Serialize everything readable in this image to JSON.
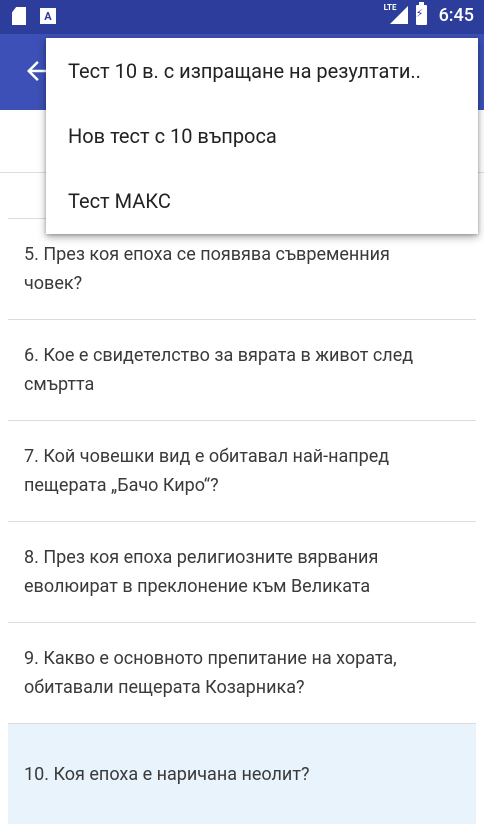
{
  "status_bar": {
    "time": "6:45",
    "a_glyph": "A",
    "network_label": "LTE",
    "icons": [
      "sd-card-icon",
      "a-notification-icon",
      "lte-signal-icon",
      "battery-charging-icon"
    ]
  },
  "app_bar": {
    "back_icon": "arrow-back-icon",
    "color": "#3c50b7"
  },
  "menu": {
    "items": [
      {
        "label": "Тест 10 в. с изпращане на резултати.."
      },
      {
        "label": "Нов тест с 10 въпроса"
      },
      {
        "label": "Тест МАКС"
      }
    ]
  },
  "questions": [
    {
      "text": "5. През коя епоха се появява съвременния човек?"
    },
    {
      "text": "6. Кое е свидетелство за вярата в живот след смъртта"
    },
    {
      "text": "7. Кой човешки вид е обитавал най-напред пещерата „Бачо Киро“?"
    },
    {
      "text": "8. През коя епоха религиозните вярвания еволюират в преклонение към Великата"
    },
    {
      "text": "9. Какво е основното препитание на хората, обитавали пещерата Козарника?"
    },
    {
      "text": "10. Коя епоха е наричана неолит?"
    }
  ],
  "colors": {
    "status_bar": "#2c3d9c",
    "selected_row": "#e8f3fc"
  }
}
